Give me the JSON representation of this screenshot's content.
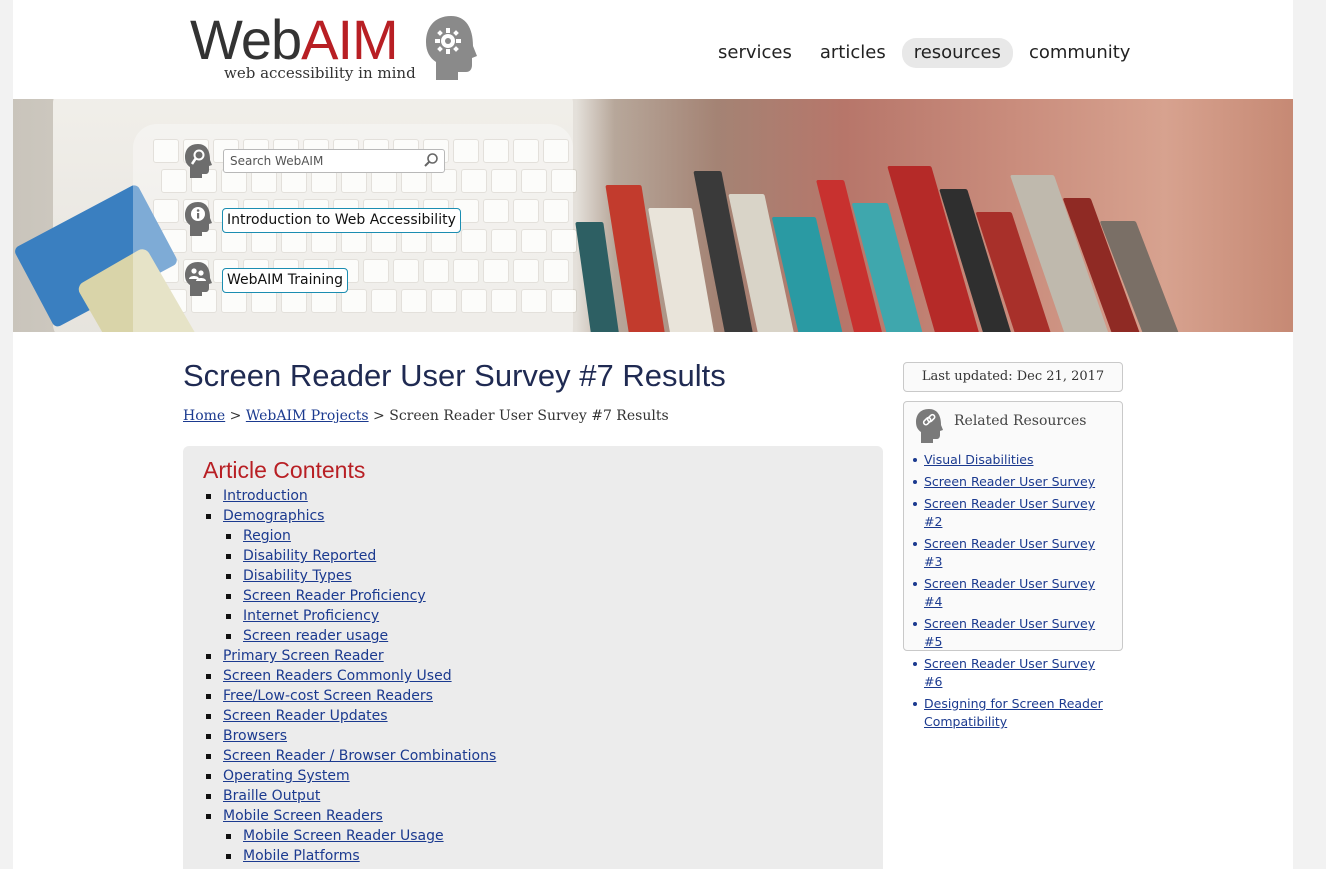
{
  "header": {
    "logo_web": "Web",
    "logo_aim": "AIM",
    "logo_tagline": "web accessibility in mind",
    "nav": [
      {
        "label": "services",
        "active": false
      },
      {
        "label": "articles",
        "active": false
      },
      {
        "label": "resources",
        "active": true
      },
      {
        "label": "community",
        "active": false
      }
    ]
  },
  "banner": {
    "search_placeholder": "Search WebAIM",
    "link_intro": "Introduction to Web Accessibility",
    "link_training": "WebAIM Training"
  },
  "main": {
    "title": "Screen Reader User Survey #7 Results",
    "breadcrumb": {
      "home": "Home",
      "sep1": " > ",
      "projects": "WebAIM Projects",
      "sep2": " > ",
      "current": "Screen Reader User Survey #7 Results"
    },
    "toc": {
      "title": "Article Contents",
      "items": [
        {
          "label": "Introduction"
        },
        {
          "label": "Demographics",
          "children": [
            {
              "label": "Region"
            },
            {
              "label": "Disability Reported"
            },
            {
              "label": "Disability Types"
            },
            {
              "label": "Screen Reader Proficiency"
            },
            {
              "label": "Internet Proficiency"
            },
            {
              "label": "Screen reader usage"
            }
          ]
        },
        {
          "label": "Primary Screen Reader"
        },
        {
          "label": "Screen Readers Commonly Used"
        },
        {
          "label": "Free/Low-cost Screen Readers"
        },
        {
          "label": "Screen Reader Updates"
        },
        {
          "label": "Browsers"
        },
        {
          "label": "Screen Reader / Browser Combinations"
        },
        {
          "label": "Operating System"
        },
        {
          "label": "Braille Output"
        },
        {
          "label": "Mobile Screen Readers",
          "children": [
            {
              "label": "Mobile Screen Reader Usage"
            },
            {
              "label": "Mobile Platforms"
            }
          ]
        }
      ]
    }
  },
  "sidebar": {
    "last_updated": "Last updated: Dec 21, 2017",
    "related_title": "Related Resources",
    "related": [
      "Visual Disabilities",
      "Screen Reader User Survey",
      "Screen Reader User Survey #2",
      "Screen Reader User Survey #3",
      "Screen Reader User Survey #4",
      "Screen Reader User Survey #5",
      "Screen Reader User Survey #6",
      "Designing for Screen Reader Compatibility"
    ]
  },
  "colors": {
    "brand_red": "#b81f24",
    "link_blue": "#1b3a8f",
    "title_navy": "#1f2a52"
  }
}
